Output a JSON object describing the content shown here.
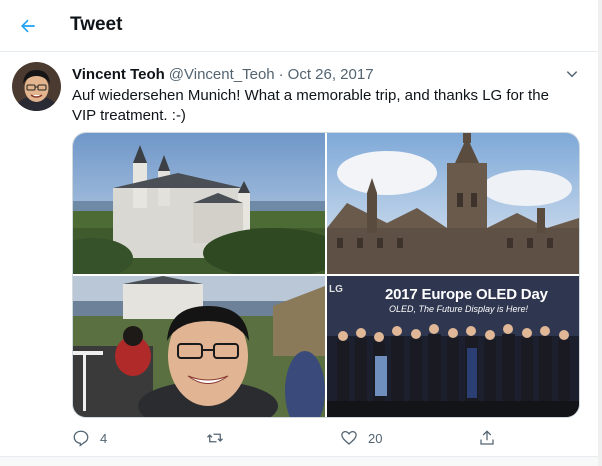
{
  "header": {
    "title": "Tweet",
    "back_icon": "arrow-left-icon"
  },
  "tweet": {
    "author": {
      "name": "Vincent Teoh",
      "handle": "@Vincent_Teoh"
    },
    "separator": "·",
    "date": "Oct 26, 2017",
    "text": "Auf wiedersehen Munich! What a memorable trip, and thanks LG for the VIP treatment. :-)",
    "media": {
      "photo4_logo": "LG",
      "photo4_banner": "2017 Europe OLED Day",
      "photo4_tagline": "OLED, The Future Display is Here!"
    },
    "actions": {
      "reply_count": "4",
      "retweet_count": "",
      "like_count": "20"
    }
  },
  "colors": {
    "accent": "#1da1f2",
    "secondary_text": "#536471",
    "border": "#e6ecf0"
  }
}
